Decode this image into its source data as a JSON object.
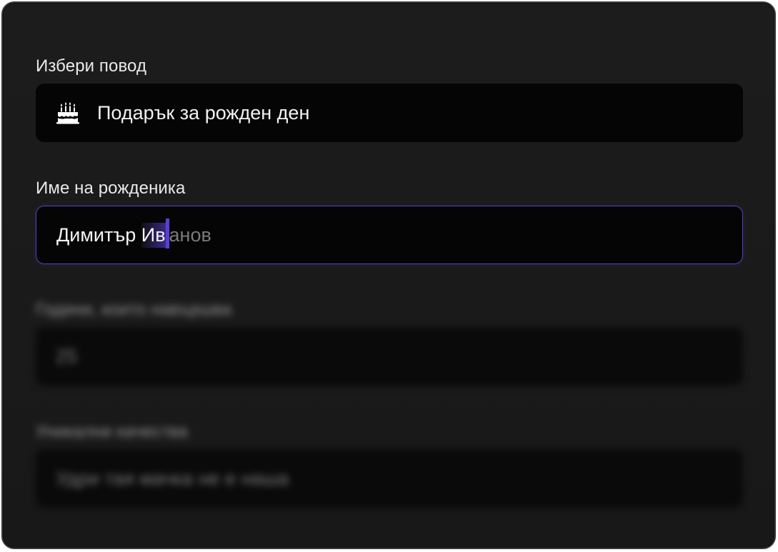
{
  "occasion": {
    "label": "Избери повод",
    "icon": "birthday-cake-icon",
    "value": "Подарък за рожден ден"
  },
  "name": {
    "label": "Име на рожденика",
    "typed": "Димитър ",
    "selected": "Ив",
    "suggestion": "анов",
    "accent": "#5b3fd4"
  },
  "age": {
    "label": "Години, които навършва",
    "value": "25"
  },
  "qualities": {
    "label": "Уникални качества",
    "value": "Удри тая мачка не е наша"
  }
}
